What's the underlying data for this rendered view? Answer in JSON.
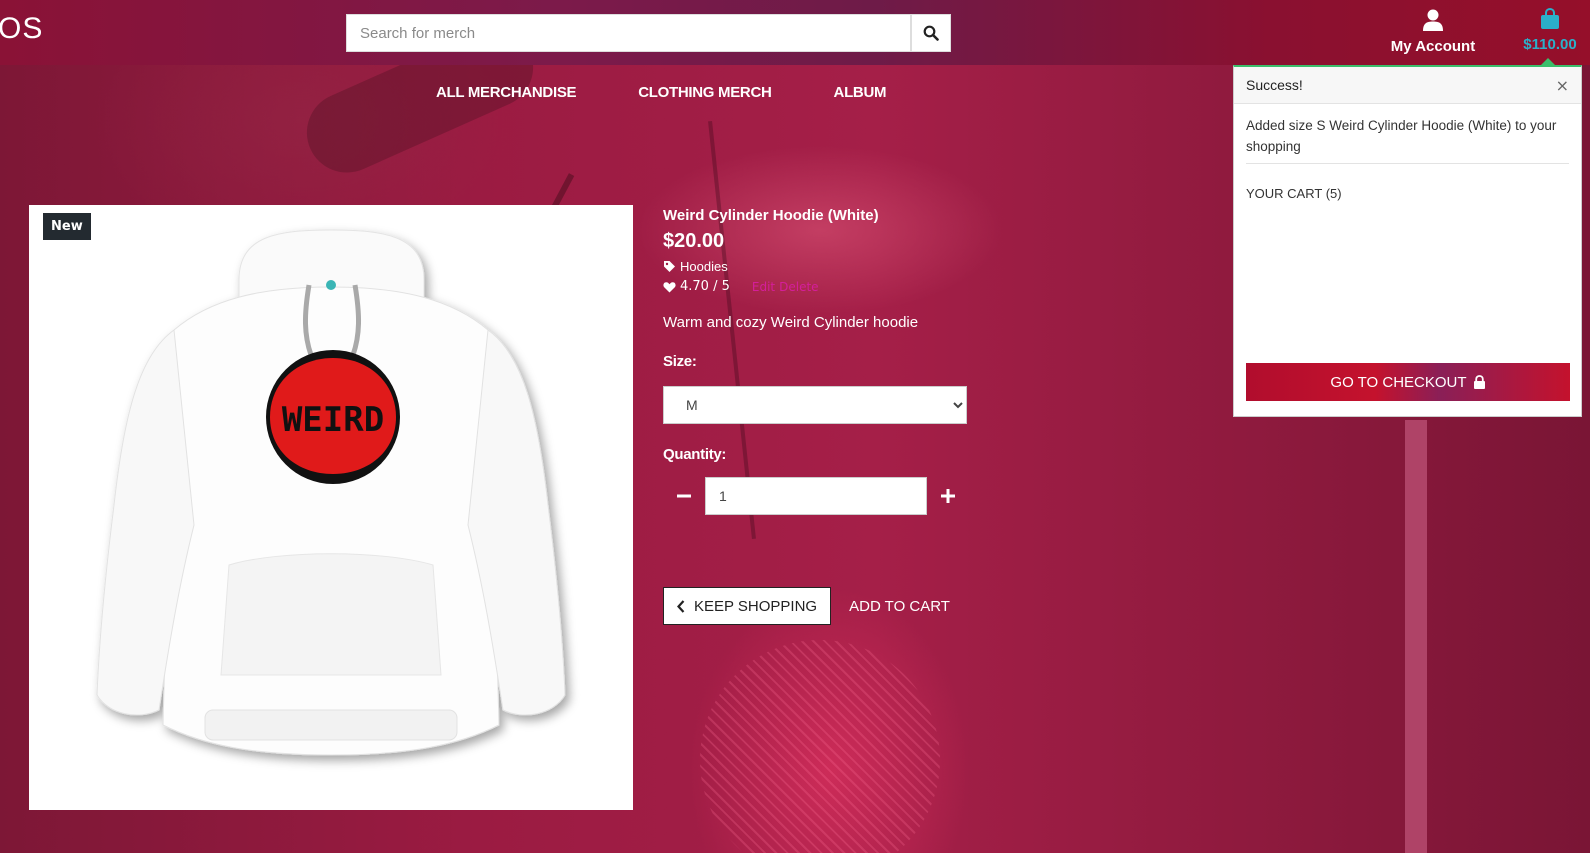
{
  "header": {
    "logo_text": "OS",
    "search": {
      "placeholder": "Search for merch",
      "value": ""
    },
    "account_label": "My Account",
    "cart_total": "$110.00"
  },
  "nav": {
    "items": [
      {
        "label": "ALL MERCHANDISE"
      },
      {
        "label": "CLOTHING MERCH"
      },
      {
        "label": "ALBUM"
      }
    ]
  },
  "product": {
    "badge": "New",
    "image_text": "WEIRD",
    "title": "Weird Cylinder Hoodie (White)",
    "price": "$20.00",
    "category": "Hoodies",
    "rating": "4.70 / 5",
    "edit_label": "Edit",
    "delete_label": "Delete",
    "description": "Warm and cozy Weird Cylinder hoodie",
    "size_label": "Size:",
    "size_selected": "M",
    "quantity_label": "Quantity:",
    "quantity_value": "1",
    "keep_shopping_label": "KEEP SHOPPING",
    "add_to_cart_label": "ADD TO CART"
  },
  "cart_popover": {
    "title": "Success!",
    "close": "×",
    "message": "Added size S Weird Cylinder Hoodie (White) to your shopping",
    "cart_summary": "YOUR CART (5)",
    "checkout_label": "GO TO CHECKOUT"
  },
  "colors": {
    "accent_cart": "#2bb0c9",
    "success_border": "#3bbe6b",
    "checkout_red": "#c4122d",
    "edit_link": "#d51e9a"
  },
  "icons": [
    "search-icon",
    "user-icon",
    "shopping-bag-icon",
    "tag-icon",
    "heart-icon",
    "minus-icon",
    "plus-icon",
    "chevron-left-icon",
    "lock-icon",
    "close-icon"
  ]
}
